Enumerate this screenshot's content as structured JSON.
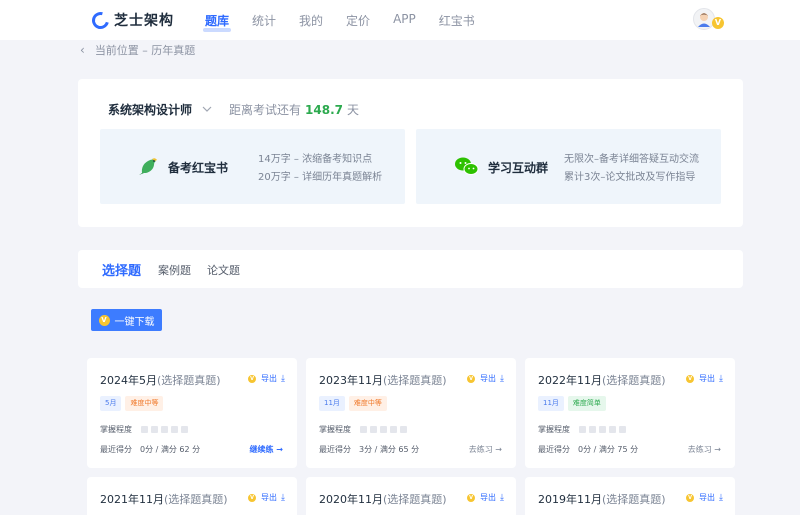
{
  "header": {
    "logo_text": "芝士架构",
    "nav": [
      "题库",
      "统计",
      "我的",
      "定价",
      "APP",
      "红宝书"
    ],
    "vip_badge": "V"
  },
  "breadcrumb": {
    "back_icon": "‹",
    "text": "当前位置 – 历年真题"
  },
  "exam": {
    "name": "系统架构设计师",
    "countdown_prefix": "距离考试还有",
    "days": "148.7",
    "countdown_suffix": "天"
  },
  "promos": [
    {
      "title": "备考红宝书",
      "icon": "parrot-icon",
      "lines": [
        "14万字 – 浓缩备考知识点",
        "20万字 – 详细历年真题解析"
      ]
    },
    {
      "title": "学习互动群",
      "icon": "wechat-icon",
      "lines": [
        "无限次–备考详细答疑互动交流",
        "累计3次–论文批改及写作指导"
      ]
    }
  ],
  "tabs": [
    "选择题",
    "案例题",
    "论文题"
  ],
  "download_button": {
    "coin": "V",
    "label": "一键下载"
  },
  "export": {
    "label": "导出",
    "coin": "V"
  },
  "cards": [
    {
      "title": "2024年5月",
      "sub": "(选择题真题)",
      "tags": [
        "5月",
        "难度中等"
      ],
      "mastery_label": "掌握程度",
      "score": "最近得分　0分 / 满分 62 分",
      "action": "继续练 →"
    },
    {
      "title": "2023年11月",
      "sub": "(选择题真题)",
      "tags": [
        "11月",
        "难度中等"
      ],
      "mastery_label": "掌握程度",
      "score": "最近得分　3分 / 满分 65 分",
      "action": "去练习 →"
    },
    {
      "title": "2022年11月",
      "sub": "(选择题真题)",
      "tags": [
        "11月",
        "难度简单"
      ],
      "mastery_label": "掌握程度",
      "score": "最近得分　0分 / 满分 75 分",
      "action": "去练习 →"
    },
    {
      "title": "2021年11月",
      "sub": "(选择题真题)"
    },
    {
      "title": "2020年11月",
      "sub": "(选择题真题)"
    },
    {
      "title": "2019年11月",
      "sub": "(选择题真题)"
    }
  ],
  "colors": {
    "accent": "#2f6bff",
    "countdown": "#2daa4f",
    "coin": "#f7c531"
  }
}
